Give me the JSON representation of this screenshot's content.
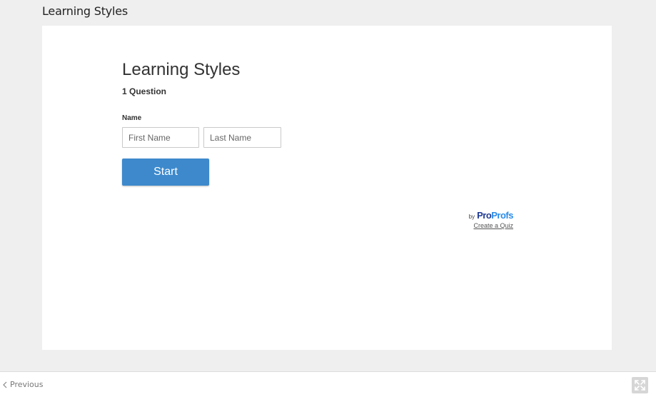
{
  "page": {
    "title": "Learning Styles"
  },
  "quiz": {
    "title": "Learning Styles",
    "question_count": "1 Question",
    "name_label": "Name",
    "first_name_placeholder": "First Name",
    "last_name_placeholder": "Last Name",
    "start_label": "Start"
  },
  "branding": {
    "by": "by",
    "logo_part1": "Pro",
    "logo_part2": "Profs",
    "create_link": "Create a Quiz"
  },
  "footer": {
    "previous_label": "Previous",
    "previous_icon": "chevron-left-icon",
    "fullscreen_icon": "expand-icon"
  },
  "colors": {
    "accent": "#3d89cc",
    "background": "#efefef",
    "brand_dark": "#1f3a93",
    "brand_light": "#2a8be8"
  }
}
